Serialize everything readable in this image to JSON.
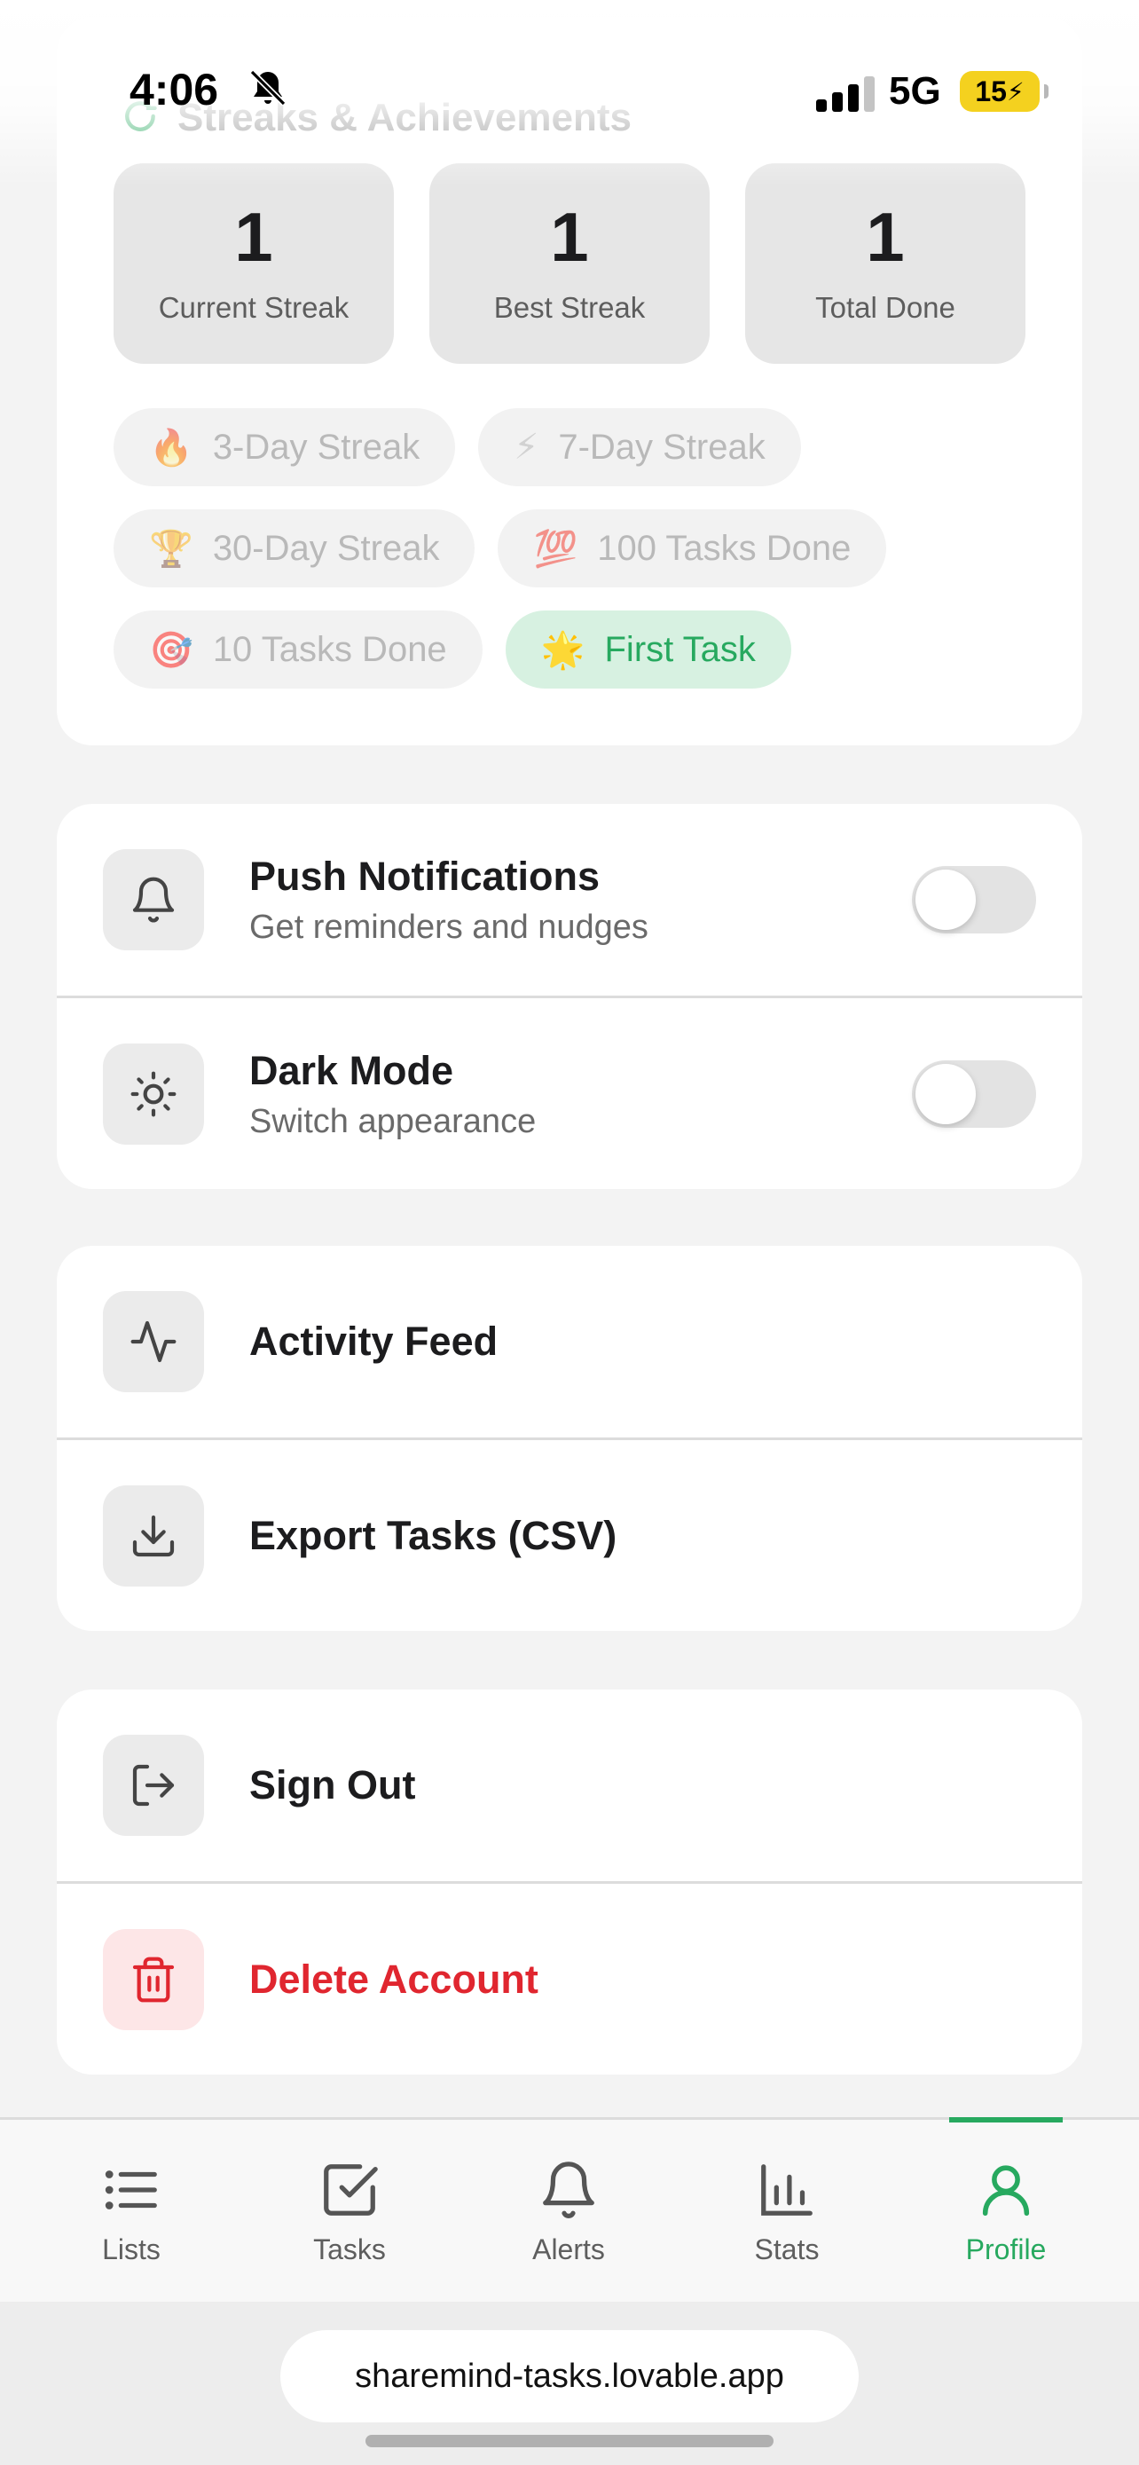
{
  "status_bar": {
    "time": "4:06",
    "network": "5G",
    "battery": "15"
  },
  "streaks": {
    "title": "Streaks & Achievements",
    "stats": [
      {
        "value": "1",
        "label": "Current Streak"
      },
      {
        "value": "1",
        "label": "Best Streak"
      },
      {
        "value": "1",
        "label": "Total Done"
      }
    ],
    "badges": [
      {
        "emoji": "🔥",
        "label": "3-Day Streak",
        "earned": false
      },
      {
        "emoji": "⚡",
        "label": "7-Day Streak",
        "earned": false
      },
      {
        "emoji": "🏆",
        "label": "30-Day Streak",
        "earned": false
      },
      {
        "emoji": "💯",
        "label": "100 Tasks Done",
        "earned": false
      },
      {
        "emoji": "🎯",
        "label": "10 Tasks Done",
        "earned": false
      },
      {
        "emoji": "🌟",
        "label": "First Task",
        "earned": true
      }
    ]
  },
  "preferences": {
    "push": {
      "title": "Push Notifications",
      "subtitle": "Get reminders and nudges",
      "enabled": false,
      "icon": "bell-icon"
    },
    "dark": {
      "title": "Dark Mode",
      "subtitle": "Switch appearance",
      "enabled": false,
      "icon": "sun-icon"
    }
  },
  "tools": {
    "activity": {
      "title": "Activity Feed",
      "icon": "activity-icon"
    },
    "export": {
      "title": "Export Tasks (CSV)",
      "icon": "download-icon"
    }
  },
  "account": {
    "sign_out": {
      "title": "Sign Out",
      "icon": "log-out-icon"
    },
    "delete": {
      "title": "Delete Account",
      "icon": "trash-icon"
    }
  },
  "tabs": [
    {
      "label": "Lists",
      "icon": "list-icon",
      "active": false
    },
    {
      "label": "Tasks",
      "icon": "checkbox-icon",
      "active": false
    },
    {
      "label": "Alerts",
      "icon": "bell-icon",
      "active": false
    },
    {
      "label": "Stats",
      "icon": "bar-chart-icon",
      "active": false
    },
    {
      "label": "Profile",
      "icon": "user-icon",
      "active": true
    }
  ],
  "browser": {
    "url": "sharemind-tasks.lovable.app"
  },
  "colors": {
    "accent": "#27a95f",
    "danger": "#e0262f",
    "badge_earned_bg": "#d7f1e1"
  }
}
